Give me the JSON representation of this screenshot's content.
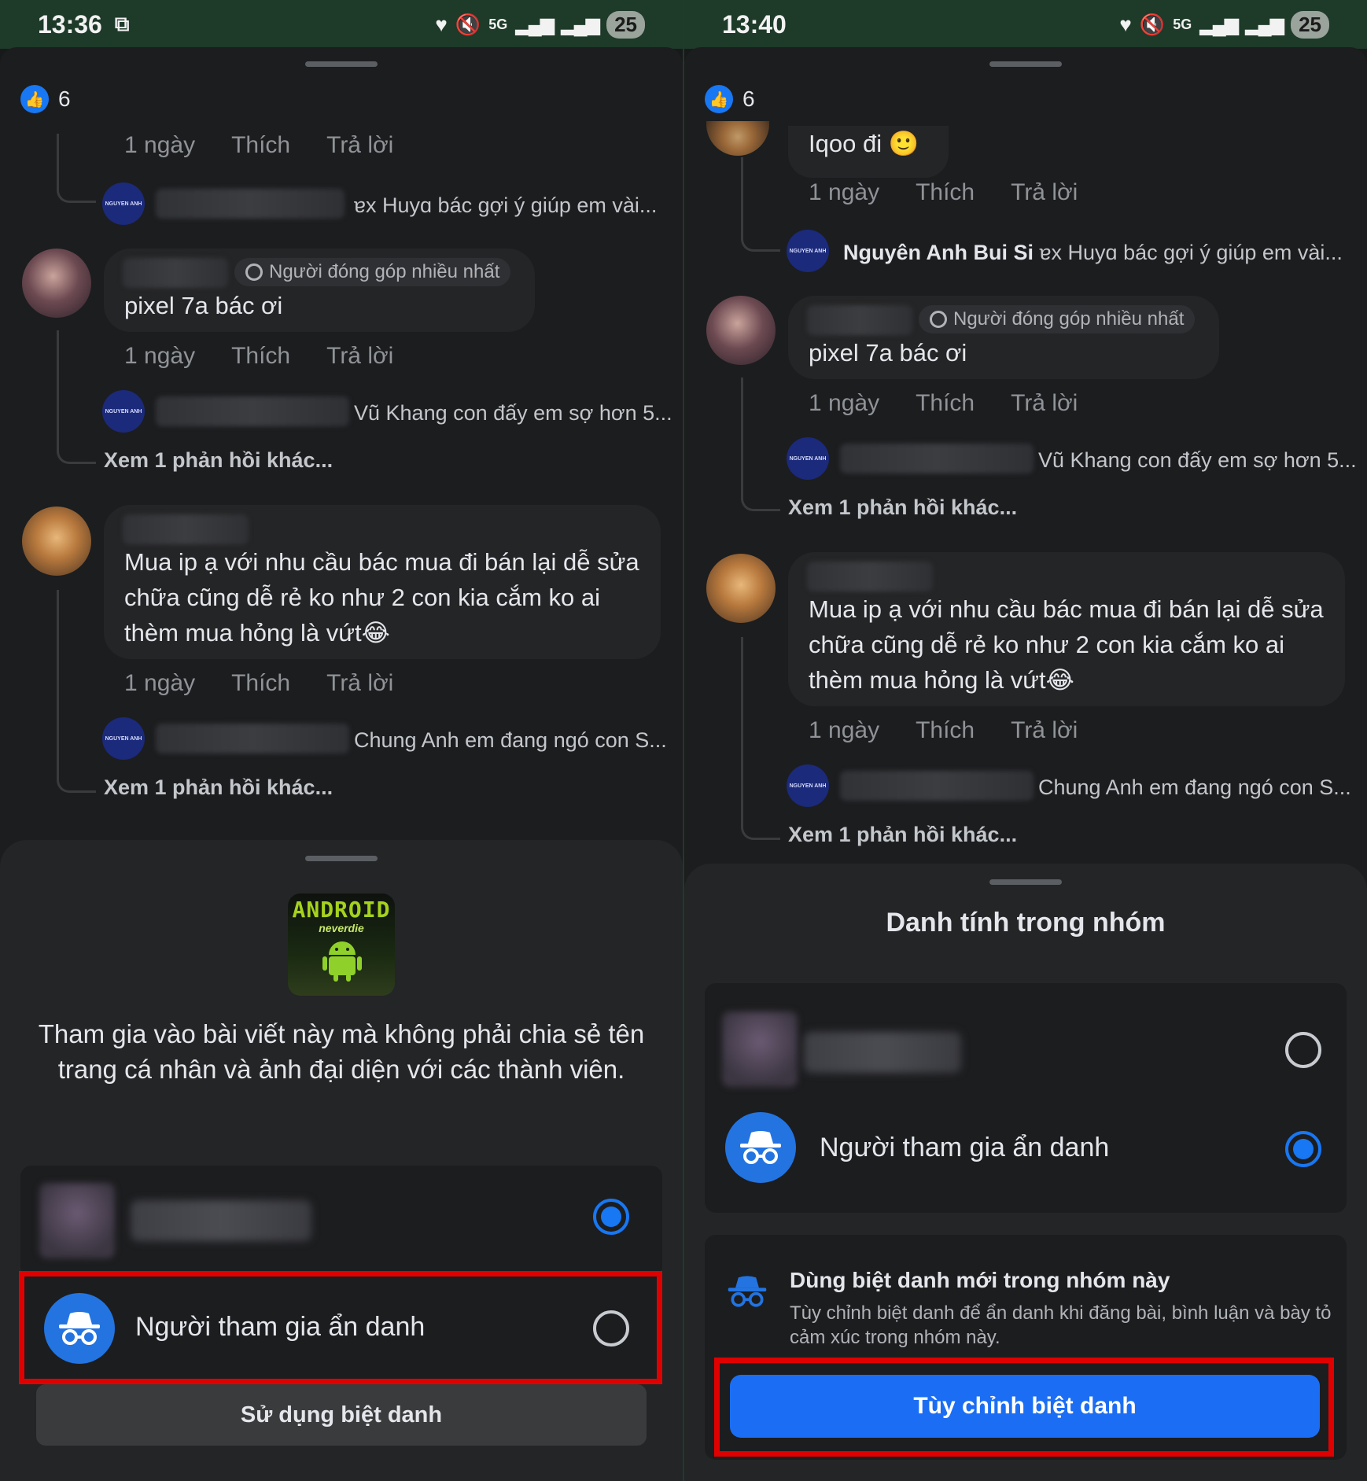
{
  "left": {
    "status": {
      "time": "13:36",
      "battery": "25"
    },
    "likes": "6",
    "meta": {
      "time": "1 ngày",
      "like": "Thích",
      "reply": "Trả lời"
    },
    "replies": [
      "ɐx Huyɑ bác gợi ý giúp em vài...",
      "Vũ Khang con đấy em sợ hơn 5...",
      "Chung Anh em đang ngó con S..."
    ],
    "badge": "Người đóng góp nhiều nhất",
    "comment1": "pixel 7a bác ơi",
    "comment2": "Mua ip ạ với nhu cầu bác mua đi bán lại dễ sửa chữa cũng dễ rẻ ko như 2 con kia cắm ko ai thèm mua hỏng là vứt😂",
    "more_replies": "Xem 1 phản hồi khác...",
    "logo": {
      "title": "ANDROID",
      "sub": "neverdie"
    },
    "explain": "Tham gia vào bài viết này mà không phải chia sẻ tên trang cá nhân và ảnh đại diện với các thành viên.",
    "anon_label": "Người tham gia ẩn danh",
    "nickname_button": "Sử dụng biệt danh"
  },
  "right": {
    "status": {
      "time": "13:40",
      "battery": "25"
    },
    "likes": "6",
    "top_comment": "Iqoo đi 🙂",
    "meta": {
      "time": "1 ngày",
      "like": "Thích",
      "reply": "Trả lời"
    },
    "reply1_name": "Nguyên Anh Bui Si",
    "reply1_text": "ɐx Huyɑ bác gợi ý giúp em vài...",
    "reply2_text": "Vũ Khang con đấy em sợ hơn 5...",
    "reply3_text": "Chung Anh em đang ngó con S...",
    "badge": "Người đóng góp nhiều nhất",
    "comment1": "pixel 7a bác ơi",
    "comment2": "Mua ip ạ với nhu cầu bác mua đi bán lại dễ sửa chữa cũng dễ rẻ ko như 2 con kia cắm ko ai thèm mua hỏng là vứt😂",
    "more_replies": "Xem 1 phản hồi khác...",
    "sheet_title": "Danh tính trong nhóm",
    "anon_label": "Người tham gia ẩn danh",
    "nick_title": "Dùng biệt danh mới trong nhóm này",
    "nick_desc": "Tùy chỉnh biệt danh để ẩn danh khi đăng bài, bình luận và bày tỏ cảm xúc trong nhóm này.",
    "nick_button": "Tùy chỉnh biệt danh"
  },
  "colors": {
    "accent": "#1877f2",
    "highlight": "#e00000",
    "background": "#18191a"
  }
}
